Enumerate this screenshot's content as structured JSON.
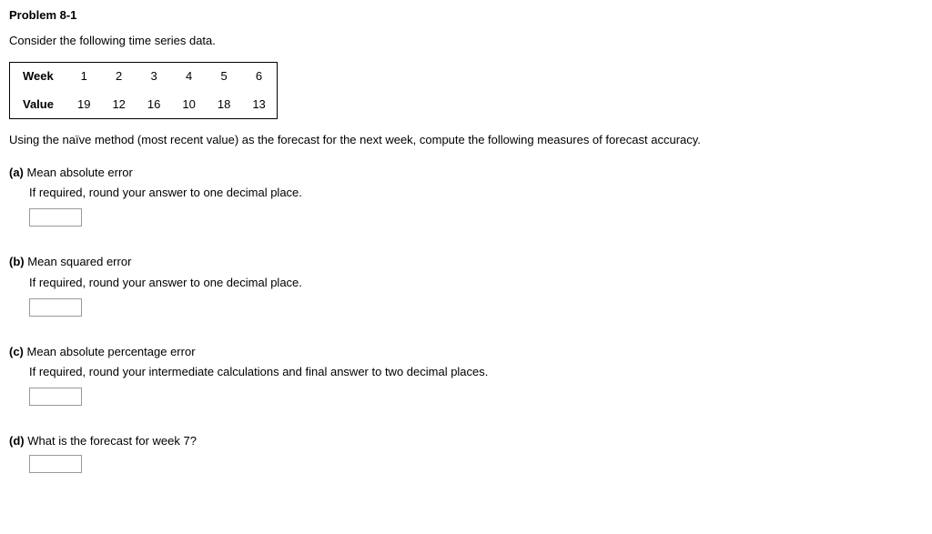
{
  "title": "Problem 8-1",
  "intro": "Consider the following time series data.",
  "table": {
    "row1_label": "Week",
    "row1": [
      "1",
      "2",
      "3",
      "4",
      "5",
      "6"
    ],
    "row2_label": "Value",
    "row2": [
      "19",
      "12",
      "16",
      "10",
      "18",
      "13"
    ]
  },
  "instruction": "Using the naïve method (most recent value) as the forecast for the next week, compute the following measures of forecast accuracy.",
  "parts": {
    "a": {
      "label": "(a)",
      "title": "Mean absolute error",
      "note": "If required, round your answer to one decimal place."
    },
    "b": {
      "label": "(b)",
      "title": "Mean squared error",
      "note": "If required, round your answer to one decimal place."
    },
    "c": {
      "label": "(c)",
      "title": "Mean absolute percentage error",
      "note": "If required, round your intermediate calculations and final answer to two decimal places."
    },
    "d": {
      "label": "(d)",
      "title": "What is the forecast for week 7?"
    }
  }
}
